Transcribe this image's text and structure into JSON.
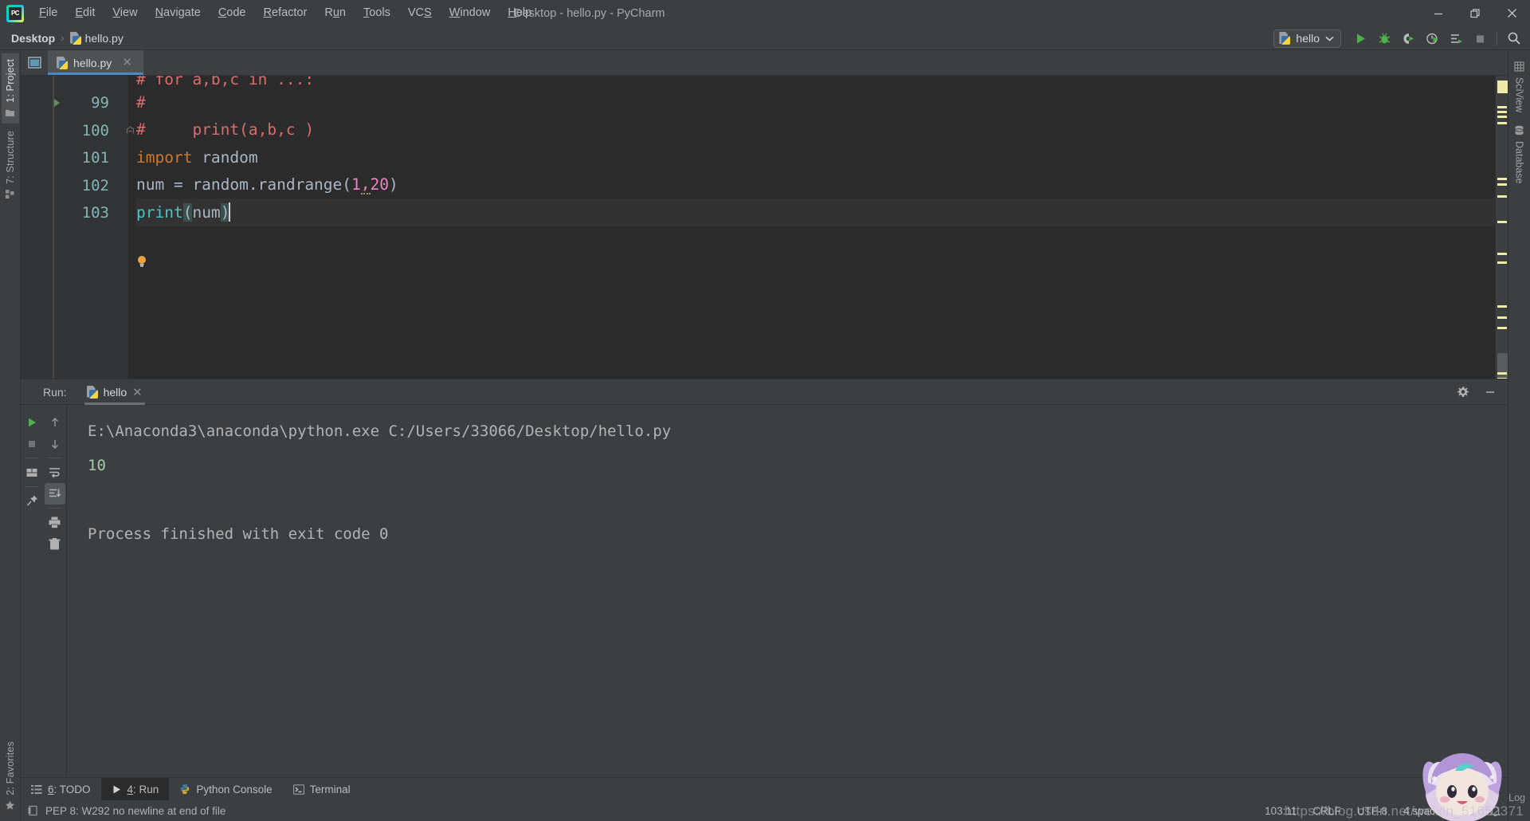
{
  "window": {
    "title": "Desktop - hello.py - PyCharm",
    "app_logo": "pycharm-logo",
    "controls": {
      "minimize": "minimize-icon",
      "maximize": "maximize-icon",
      "close": "close-icon"
    }
  },
  "menubar": {
    "items": [
      {
        "label": "File",
        "mnemonic": "F"
      },
      {
        "label": "Edit",
        "mnemonic": "E"
      },
      {
        "label": "View",
        "mnemonic": "V"
      },
      {
        "label": "Navigate",
        "mnemonic": "N"
      },
      {
        "label": "Code",
        "mnemonic": "C"
      },
      {
        "label": "Refactor",
        "mnemonic": "R"
      },
      {
        "label": "Run",
        "mnemonic": "u"
      },
      {
        "label": "Tools",
        "mnemonic": "T"
      },
      {
        "label": "VCS",
        "mnemonic": "S"
      },
      {
        "label": "Window",
        "mnemonic": "W"
      },
      {
        "label": "Help",
        "mnemonic": "H"
      }
    ]
  },
  "navbar": {
    "breadcrumbs": [
      {
        "label": "Desktop",
        "icon": ""
      },
      {
        "label": "hello.py",
        "icon": "python-file-icon"
      }
    ],
    "separator": "›",
    "run_config": {
      "name": "hello",
      "icon": "python-config-icon",
      "chevron": "chevron-down-icon"
    },
    "toolbar_buttons": [
      {
        "name": "run-button",
        "icon": "run-icon"
      },
      {
        "name": "debug-button",
        "icon": "bug-icon"
      },
      {
        "name": "run-coverage-button",
        "icon": "coverage-icon"
      },
      {
        "name": "profile-button",
        "icon": "profiler-icon"
      },
      {
        "name": "run-with-console-button",
        "icon": "run-console-icon"
      },
      {
        "name": "stop-button",
        "icon": "stop-icon"
      },
      {
        "name": "search-everywhere-button",
        "icon": "search-icon"
      }
    ]
  },
  "left_strip": {
    "top": [
      {
        "label": "1: Project",
        "mnemonic": "1",
        "icon": "project-folder-icon",
        "active": true
      },
      {
        "label": "7: Structure",
        "mnemonic": "7",
        "icon": "structure-icon",
        "active": false
      }
    ],
    "bottom": [
      {
        "label": "2: Favorites",
        "mnemonic": "2",
        "icon": "star-icon",
        "active": false
      }
    ]
  },
  "right_strip": {
    "items": [
      {
        "label": "SciView",
        "icon": "grid-icon"
      },
      {
        "label": "Database",
        "icon": "database-icon"
      }
    ],
    "log_label": "Log"
  },
  "editor": {
    "tabs": [
      {
        "label": "hello.py",
        "icon": "python-file-icon",
        "active": true,
        "close": "close-icon"
      }
    ],
    "toggle_panel_icon": "toggle-panel-icon",
    "first_line_partial": "# for a,b,c in ...:",
    "lines": [
      {
        "number": "99",
        "tokens": [
          {
            "t": "#",
            "c": "com"
          }
        ],
        "current": false,
        "fold": false,
        "runmark": true
      },
      {
        "number": "100",
        "tokens": [
          {
            "t": "#     print(a,b,c )",
            "c": "com"
          }
        ],
        "current": false,
        "fold": true,
        "runmark": false
      },
      {
        "number": "101",
        "tokens": [
          {
            "t": "import",
            "c": "kw"
          },
          {
            "t": " random",
            "c": "id"
          }
        ],
        "current": false,
        "fold": false,
        "runmark": false
      },
      {
        "number": "102",
        "tokens": [
          {
            "t": "num = random.randrange(",
            "c": "id"
          },
          {
            "t": "1",
            "c": "num2"
          },
          {
            "t": ",",
            "c": "squig"
          },
          {
            "t": "20",
            "c": "num2"
          },
          {
            "t": ")",
            "c": "id"
          }
        ],
        "current": false,
        "fold": false,
        "runmark": false
      },
      {
        "number": "103",
        "tokens": [
          {
            "t": "print",
            "c": "fn"
          },
          {
            "t": "(",
            "c": "brace"
          },
          {
            "t": "num",
            "c": "id"
          },
          {
            "t": ")",
            "c": "brace"
          }
        ],
        "current": true,
        "fold": false,
        "runmark": false
      }
    ],
    "inspection_bulb": "intention-bulb-icon"
  },
  "run_window": {
    "label": "Run:",
    "tab": {
      "name": "hello",
      "icon": "python-config-icon",
      "close": "close-icon"
    },
    "header_buttons": [
      {
        "name": "settings-button",
        "icon": "gear-icon"
      },
      {
        "name": "hide-button",
        "icon": "minimize-icon"
      }
    ],
    "side_buttons_col1": [
      {
        "name": "rerun-button",
        "icon": "run-icon"
      },
      {
        "name": "stop-button",
        "icon": "stop-icon"
      },
      {
        "name": "layout-button",
        "icon": "layout-icon"
      },
      {
        "name": "pin-tab-button",
        "icon": "pin-icon"
      }
    ],
    "side_buttons_col2": [
      {
        "name": "up-stacktrace-button",
        "icon": "arrow-up-icon"
      },
      {
        "name": "down-stacktrace-button",
        "icon": "arrow-down-icon"
      },
      {
        "name": "soft-wrap-button",
        "icon": "wrap-icon"
      },
      {
        "name": "scroll-to-end-button",
        "icon": "scroll-end-icon",
        "selected": true
      },
      {
        "name": "print-button",
        "icon": "printer-icon"
      },
      {
        "name": "clear-all-button",
        "icon": "trash-icon"
      }
    ],
    "console": {
      "command": "E:\\Anaconda3\\anaconda\\python.exe C:/Users/33066/Desktop/hello.py",
      "output": "10",
      "exit_message": "Process finished with exit code 0"
    }
  },
  "bottom_tabs": [
    {
      "label": "6: TODO",
      "mnemonic": "6",
      "icon": "todo-icon",
      "active": false
    },
    {
      "label": "4: Run",
      "mnemonic": "4",
      "icon": "run-icon",
      "active": true
    },
    {
      "label": "Python Console",
      "mnemonic": "",
      "icon": "python-console-icon",
      "active": false
    },
    {
      "label": "Terminal",
      "mnemonic": "",
      "icon": "terminal-icon",
      "active": false
    }
  ],
  "status_bar": {
    "message": "PEP 8: W292 no newline at end of file",
    "message_icon": "inspection-icon",
    "caret_position": "103:11",
    "line_separator": "CRLF",
    "encoding": "UTF-8",
    "indent": "4 spaces",
    "lock_icon": "unlock-icon",
    "notification_icon": "notification-icon"
  },
  "watermark": {
    "url": "https://blog.csdn.net/weixin_51652371"
  },
  "colors": {
    "bg_chrome": "#3c3f41",
    "bg_editor": "#2b2b2b",
    "gutter": "#313335",
    "accent_tab": "#4a88c7",
    "keyword": "#cc7832",
    "comment": "#d96c6c",
    "number": "#e886c7",
    "function": "#46c8c8",
    "identifier": "#a9b7c6",
    "console_out": "#a8c9a8",
    "marker": "#efeaa8"
  }
}
